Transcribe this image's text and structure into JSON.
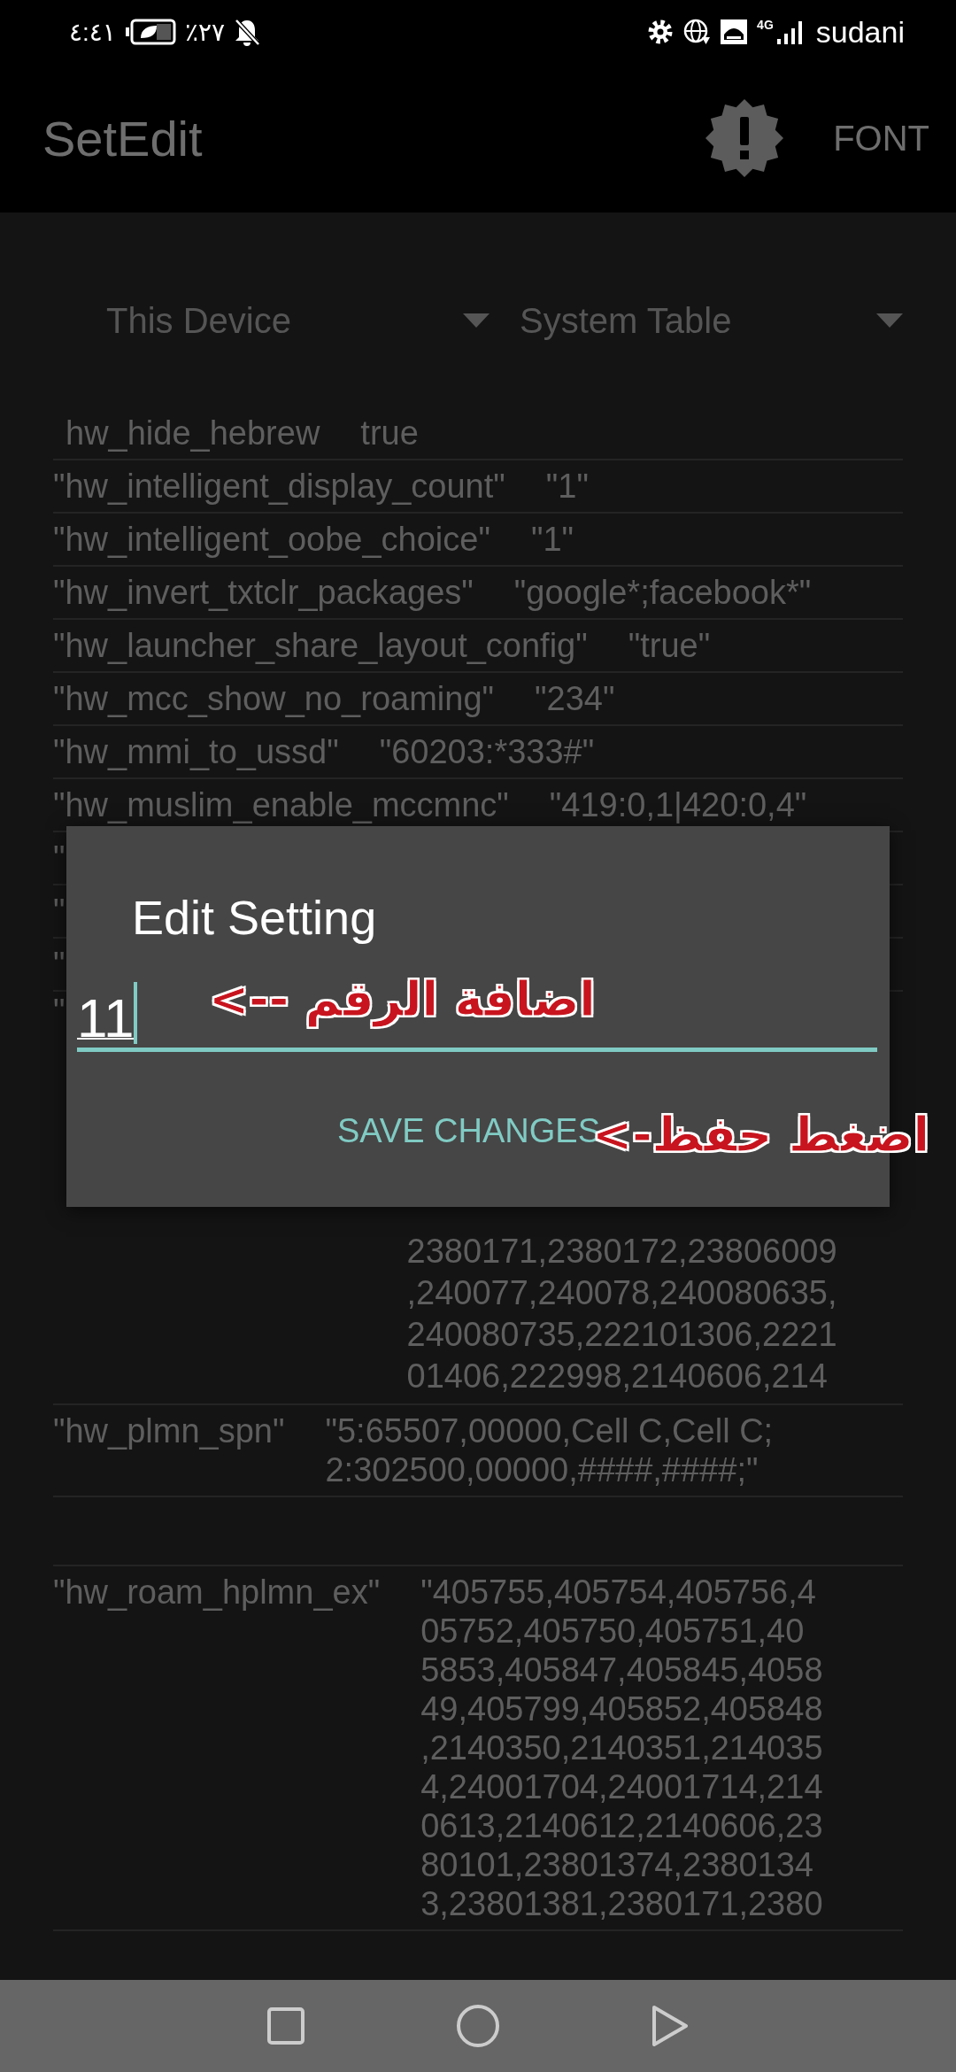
{
  "status_bar": {
    "time": "٤:٤١",
    "battery": "٪٢٧",
    "carrier": "sudani",
    "network": "4G"
  },
  "app_bar": {
    "title": "SetEdit",
    "action": "FONT"
  },
  "spinners": [
    {
      "label": "This Device"
    },
    {
      "label": "System Table"
    }
  ],
  "settings": [
    {
      "kind": "plain",
      "name": "hw_hide_hebrew",
      "value": [
        "true"
      ]
    },
    {
      "kind": "plain",
      "name": "\"hw_intelligent_display_count\"",
      "value": [
        "\"1\""
      ]
    },
    {
      "kind": "plain",
      "name": "\"hw_intelligent_oobe_choice\"",
      "value": [
        "\"1\""
      ]
    },
    {
      "kind": "plain",
      "name": "\"hw_invert_txtclr_packages\"",
      "value": [
        "\"google*;facebook*\""
      ]
    },
    {
      "kind": "plain",
      "name": "\"hw_launcher_share_layout_config\"",
      "value": [
        "\"true\""
      ]
    },
    {
      "kind": "plain",
      "name": "\"hw_mcc_show_no_roaming\"",
      "value": [
        "\"234\""
      ]
    },
    {
      "kind": "plain",
      "name": "\"hw_mmi_to_ussd\"",
      "value": [
        "\"60203:*333#\""
      ]
    },
    {
      "kind": "plain",
      "name": "\"hw_muslim_enable_mccmnc\"",
      "value": [
        "\"419:0,1|420:0,4\""
      ]
    },
    {
      "kind": "covered",
      "name": "\""
    },
    {
      "kind": "covered",
      "name": "\""
    },
    {
      "kind": "covered",
      "name": "\""
    },
    {
      "kind": "tall",
      "name": "\"",
      "value": [
        "2380171,2380172,23806009",
        ",240077,240078,240080635,",
        "240080735,222101306,2221",
        "01406,222998,2140606,214"
      ]
    },
    {
      "kind": "plain",
      "name": "\"hw_plmn_spn\"",
      "value": [
        "\"5:65507,00000,Cell C,Cell C;",
        "2:302500,00000,####,####;\""
      ]
    },
    {
      "kind": "blank"
    },
    {
      "kind": "plain",
      "name": "\"hw_roam_hplmn_ex\"",
      "value": [
        "\"405755,405754,405756,4",
        "05752,405750,405751,40",
        "5853,405847,405845,4058",
        "49,405799,405852,405848",
        ",2140350,2140351,214035",
        "4,24001704,24001714,214",
        "0613,2140612,2140606,23",
        "80101,23801374,2380134",
        "3,23801381,2380171,2380"
      ]
    }
  ],
  "dialog": {
    "title": "Edit Setting",
    "value": "11",
    "button": "SAVE CHANGES"
  },
  "annotations": [
    {
      "kind": "field",
      "text": "اضافة الرقم -->"
    },
    {
      "kind": "screen",
      "text": "اضغط حفظ->"
    }
  ]
}
